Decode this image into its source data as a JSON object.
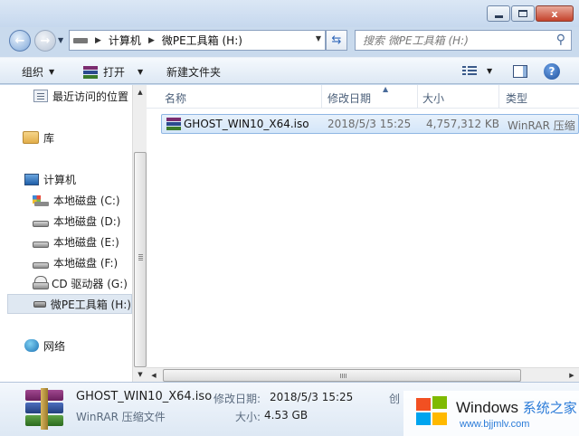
{
  "window": {
    "minimize_label": "",
    "maximize_label": "",
    "close_label": "x"
  },
  "address_bar": {
    "segments": [
      "计算机",
      "微PE工具箱 (H:)"
    ]
  },
  "search": {
    "placeholder": "搜索 微PE工具箱 (H:)"
  },
  "toolbar": {
    "organize": "组织",
    "open": "打开",
    "new_folder": "新建文件夹"
  },
  "nav_pane": {
    "items": [
      {
        "label": "最近访问的位置",
        "icon": "recent-places-icon"
      },
      {
        "label": "库",
        "icon": "library-icon"
      },
      {
        "label": "计算机",
        "icon": "computer-icon"
      },
      {
        "label": "本地磁盘 (C:)",
        "icon": "system-drive-icon"
      },
      {
        "label": "本地磁盘 (D:)",
        "icon": "hard-drive-icon"
      },
      {
        "label": "本地磁盘 (E:)",
        "icon": "hard-drive-icon"
      },
      {
        "label": "本地磁盘 (F:)",
        "icon": "hard-drive-icon"
      },
      {
        "label": "CD 驱动器 (G:)",
        "icon": "cd-drive-icon"
      },
      {
        "label": "微PE工具箱 (H:)",
        "icon": "usb-drive-icon",
        "selected": true
      },
      {
        "label": "网络",
        "icon": "network-icon"
      }
    ]
  },
  "file_list": {
    "columns": [
      "名称",
      "修改日期",
      "大小",
      "类型"
    ],
    "rows": [
      {
        "name": "GHOST_WIN10_X64.iso",
        "modified": "2018/5/3 15:25",
        "size": "4,757,312 KB",
        "type": "WinRAR 压缩"
      }
    ]
  },
  "details": {
    "name": "GHOST_WIN10_X64.iso",
    "modified_label": "修改日期:",
    "modified_value": "2018/5/3 15:25",
    "created_label": "创",
    "type": "WinRAR 压缩文件",
    "size_label": "大小:",
    "size_value": "4.53 GB"
  },
  "watermark": {
    "title": "Windows",
    "title_suffix": "系统之家",
    "url": "www.bjjmlv.com"
  }
}
